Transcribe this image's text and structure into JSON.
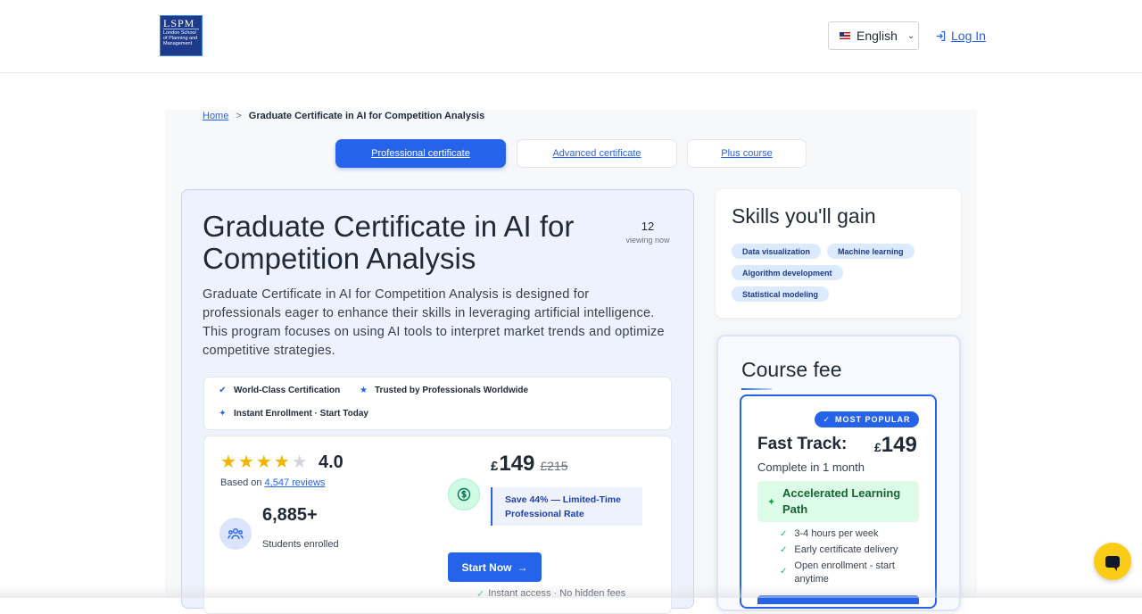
{
  "header": {
    "logo": {
      "big": "LSPM",
      "small": "London School of Planning and Management"
    },
    "language": "English",
    "login": "Log In"
  },
  "breadcrumb": {
    "home": "Home",
    "separator": ">",
    "current": "Graduate Certificate in AI for Competition Analysis"
  },
  "tabs": [
    {
      "label": "Professional certificate",
      "active": true
    },
    {
      "label": "Advanced certificate",
      "active": false
    },
    {
      "label": "Plus course",
      "active": false
    }
  ],
  "hero": {
    "title": "Graduate Certificate in AI for Competition Analysis",
    "viewing_count": "12",
    "viewing_label": "viewing now",
    "description": "Graduate Certificate in AI for Competition Analysis is designed for professionals eager to enhance their skills in leveraging artificial intelligence. This program focuses on using AI tools to interpret market trends and optimize competitive strategies."
  },
  "badges": [
    {
      "label": "World-Class Certification",
      "icon": "check-badge-icon"
    },
    {
      "label": "Trusted by Professionals Worldwide",
      "icon": "star-icon"
    },
    {
      "label": "Instant Enrollment · Start Today",
      "icon": "sparkle-icon"
    }
  ],
  "stats": {
    "rating": "4.0",
    "rating_value": 4,
    "rating_max": 5,
    "based_on": "Based on",
    "reviews": "4,547 reviews",
    "students": "6,885+",
    "students_label": "Students enrolled",
    "currency": "£",
    "price": "149",
    "old_price": "£215",
    "save_text": "Save 44% — Limited-Time Professional Rate",
    "start_label": "Start Now",
    "instant_text": "Instant access · No hidden fees"
  },
  "skills": {
    "title": "Skills you'll gain",
    "items": [
      "Data visualization",
      "Machine learning",
      "Algorithm development",
      "Statistical modeling"
    ]
  },
  "fee": {
    "title": "Course fee",
    "badge": "MOST POPULAR",
    "plan_name": "Fast Track:",
    "currency": "£",
    "price": "149",
    "duration": "Complete in 1 month",
    "highlight": "Accelerated Learning Path",
    "features": [
      "3-4 hours per week",
      "Early certificate delivery",
      "Open enrollment - start anytime"
    ]
  },
  "colors": {
    "accent": "#2563eb",
    "star": "#f5b400",
    "success": "#10b981",
    "chat": "#facc15"
  }
}
